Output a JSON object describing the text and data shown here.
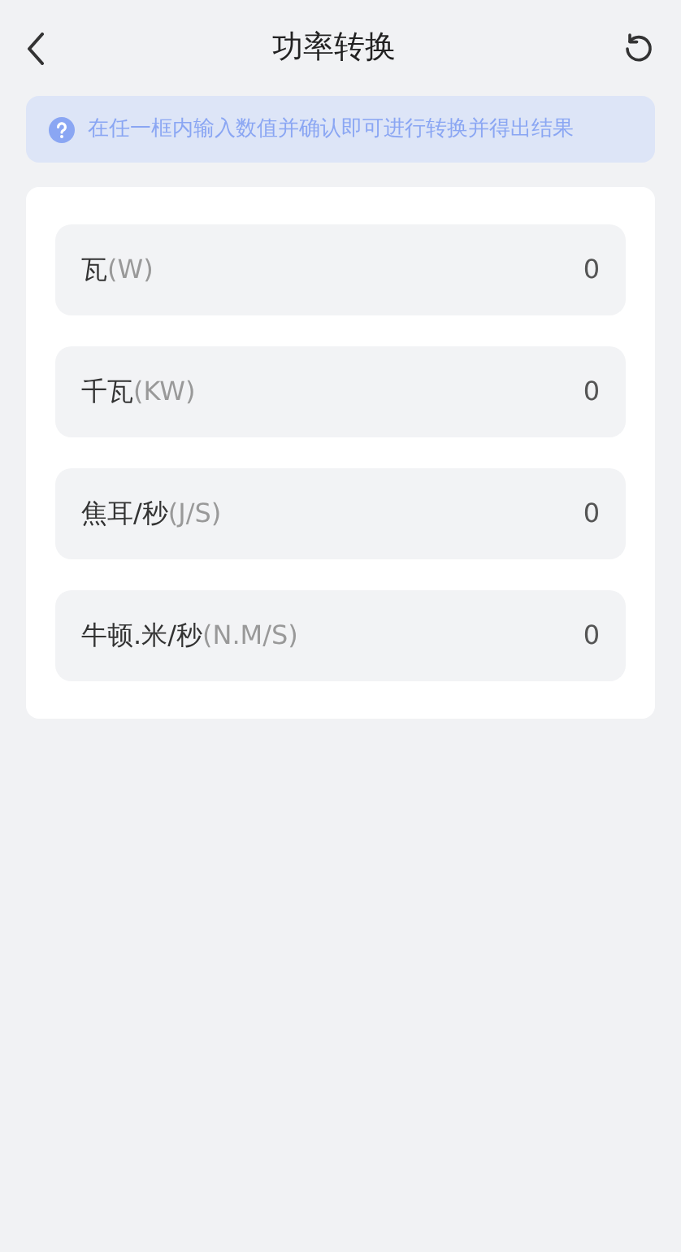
{
  "header": {
    "title": "功率转换"
  },
  "notice": {
    "text": "在任一框内输入数值并确认即可进行转换并得出结果"
  },
  "units": [
    {
      "name": "瓦",
      "unit": "(W)",
      "value": "0"
    },
    {
      "name": "千瓦",
      "unit": "(KW)",
      "value": "0"
    },
    {
      "name": "焦耳/秒",
      "unit": "(J/S)",
      "value": "0"
    },
    {
      "name": "牛顿.米/秒",
      "unit": "(N.M/S)",
      "value": "0"
    }
  ]
}
